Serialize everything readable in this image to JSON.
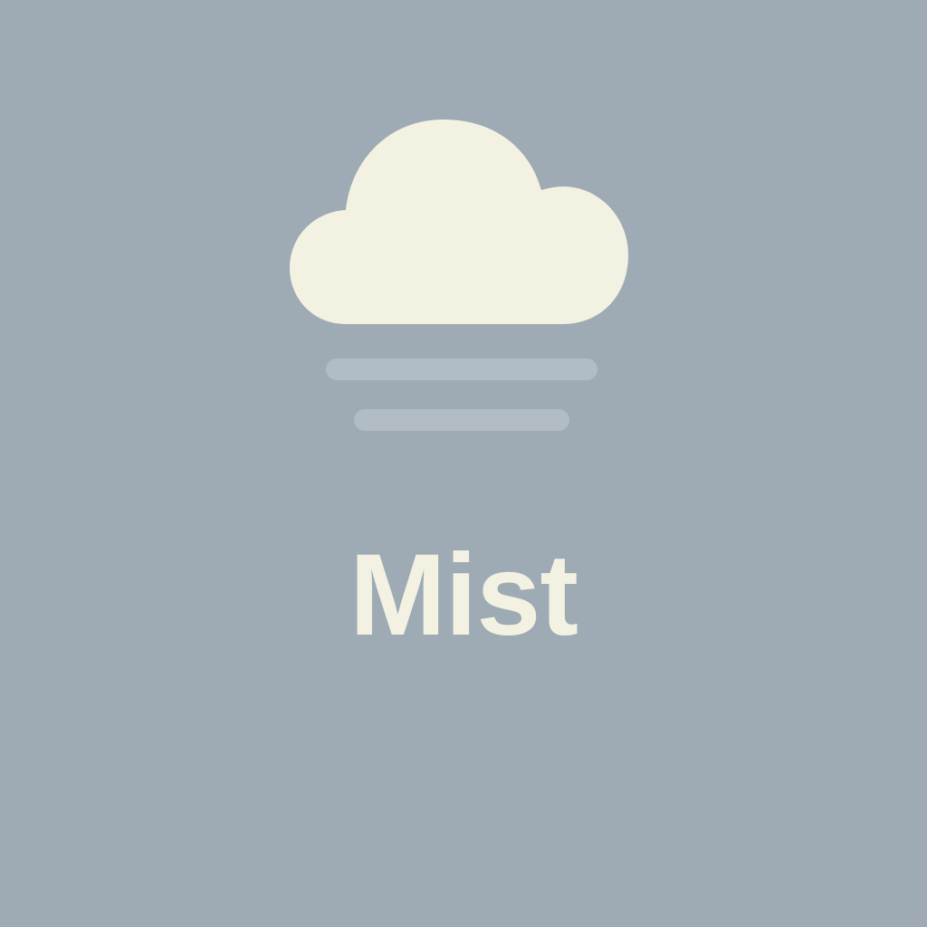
{
  "weather": {
    "condition": "Mist",
    "icon": "mist-icon"
  },
  "colors": {
    "background": "#9eaab4",
    "cloud": "#f3f1e2",
    "mist_lines": "#b1bcc4",
    "text": "#f3f1e2"
  }
}
